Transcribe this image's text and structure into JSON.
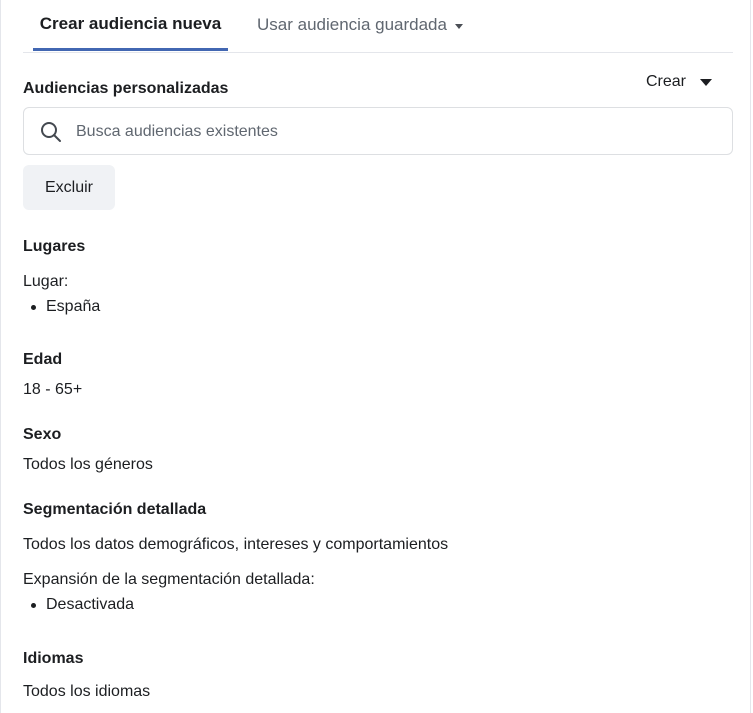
{
  "tabs": {
    "create_new": "Crear audiencia nueva",
    "use_saved": "Usar audiencia guardada"
  },
  "custom_audiences": {
    "title": "Audiencias personalizadas",
    "create_label": "Crear",
    "search_placeholder": "Busca audiencias existentes",
    "exclude_label": "Excluir"
  },
  "locations": {
    "title": "Lugares",
    "label": "Lugar:",
    "items": [
      "España"
    ]
  },
  "age": {
    "title": "Edad",
    "value": "18 - 65+"
  },
  "gender": {
    "title": "Sexo",
    "value": "Todos los géneros"
  },
  "detailed_targeting": {
    "title": "Segmentación detallada",
    "value": "Todos los datos demográficos, intereses y comportamientos",
    "expansion_label": "Expansión de la segmentación detallada:",
    "expansion_items": [
      "Desactivada"
    ]
  },
  "languages": {
    "title": "Idiomas",
    "value": "Todos los idiomas"
  },
  "colors": {
    "accent": "#4267b2",
    "text": "#1c1e21",
    "muted": "#606770",
    "button_bg": "#f0f2f5",
    "border": "#dddfe2"
  }
}
